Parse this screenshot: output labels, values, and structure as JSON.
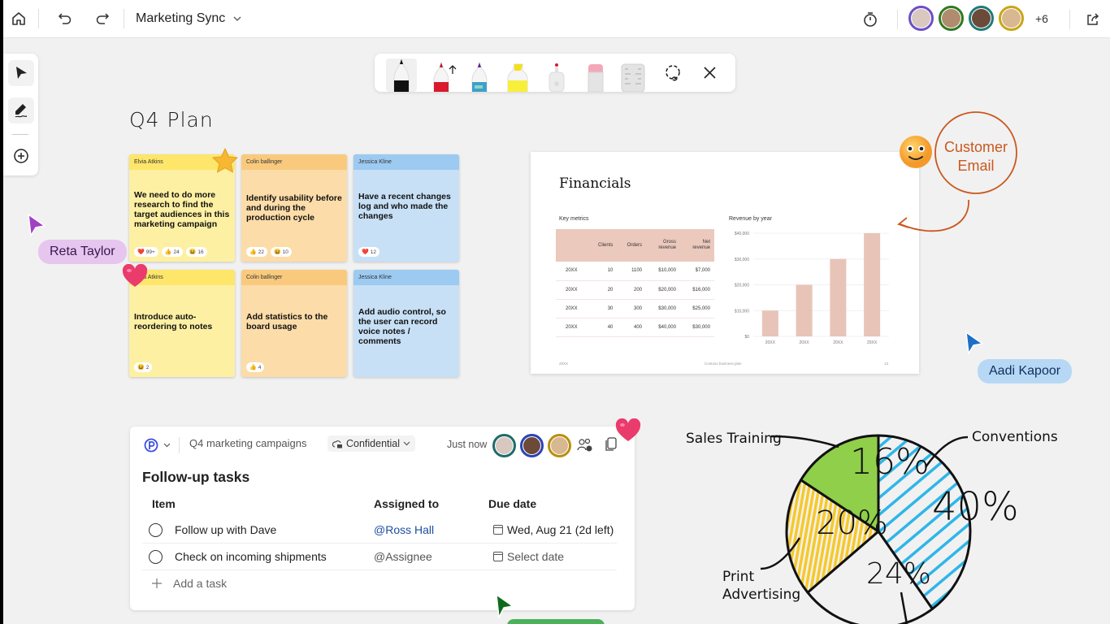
{
  "topbar": {
    "title": "Marketing Sync",
    "more_count": "+6",
    "avatars": [
      {
        "ring": "#6b4fc8",
        "fill": "#d8c8c0"
      },
      {
        "ring": "#2f7a1f",
        "fill": "#b08b6e"
      },
      {
        "ring": "#1f7a7a",
        "fill": "#6b4a3a"
      },
      {
        "ring": "#c9a515",
        "fill": "#d8b890"
      }
    ]
  },
  "leftbar": {
    "tools": [
      "select",
      "ink",
      "add"
    ]
  },
  "ink_toolbar": {
    "tools": [
      "black-pen",
      "red-pen",
      "galaxy-pen",
      "yellow-highlighter",
      "laser-pointer",
      "eraser",
      "ruler",
      "lasso-select",
      "close"
    ]
  },
  "board": {
    "title": "Q4 Plan",
    "notes": [
      {
        "author": "Elvia Atkins",
        "text": "We need to do more research to find the target audiences in this marketing campaign",
        "color": "y",
        "reactions": [
          {
            "icon": "heart",
            "count": "99+"
          },
          {
            "icon": "thumbs-up",
            "count": "24"
          },
          {
            "icon": "laugh",
            "count": "16"
          }
        ]
      },
      {
        "author": "Colin ballinger",
        "text": "Identify usability before and during the production cycle",
        "color": "o",
        "reactions": [
          {
            "icon": "thumbs-up",
            "count": "22"
          },
          {
            "icon": "laugh",
            "count": "10"
          }
        ]
      },
      {
        "author": "Jessica Kline",
        "text": "Have a recent changes log and who made the changes",
        "color": "b",
        "reactions": [
          {
            "icon": "heart",
            "count": "12"
          }
        ]
      },
      {
        "author": "Elvia Atkins",
        "text": "Introduce auto-reordering to notes",
        "color": "y",
        "reactions": [
          {
            "icon": "laugh",
            "count": "2"
          }
        ]
      },
      {
        "author": "Colin ballinger",
        "text": "Add statistics to the board usage",
        "color": "o",
        "reactions": [
          {
            "icon": "thumbs-up",
            "count": "4"
          }
        ]
      },
      {
        "author": "Jessica Kline",
        "text": "Add audio control, so the user can record voice notes / comments",
        "color": "b",
        "reactions": []
      }
    ]
  },
  "cursors": {
    "reta": {
      "name": "Reta Taylor",
      "color": "#a23fc2",
      "bg": "#e6c6ef"
    },
    "aadi": {
      "name": "Aadi Kapoor",
      "color": "#1c6fc7",
      "bg": "#b7d8f5"
    },
    "green": {
      "color": "#0f6b1c"
    }
  },
  "customer_email": {
    "label_line1": "Customer",
    "label_line2": "Email",
    "color": "#c9581f"
  },
  "slide": {
    "title": "Financials",
    "key_metrics_label": "Key metrics",
    "revenue_label": "Revenue by year",
    "table": {
      "headers": [
        "",
        "Clients",
        "Orders",
        "Gross revenue",
        "Net revenue"
      ],
      "rows": [
        [
          "20XX",
          "10",
          "1100",
          "$10,000",
          "$7,000"
        ],
        [
          "20XX",
          "20",
          "200",
          "$20,000",
          "$16,000"
        ],
        [
          "20XX",
          "30",
          "300",
          "$30,000",
          "$25,000"
        ],
        [
          "20XX",
          "40",
          "400",
          "$40,000",
          "$30,000"
        ]
      ]
    },
    "footer_left": "20XX",
    "footer_center": "Contoso business plan",
    "footer_right": "13"
  },
  "chart_data": [
    {
      "type": "bar",
      "title": "Revenue by year",
      "categories": [
        "20XX",
        "20XX",
        "20XX",
        "20XX"
      ],
      "values": [
        10000,
        20000,
        30000,
        40000
      ],
      "ylim": [
        0,
        40000
      ],
      "yticks": [
        "$0",
        "$10,000",
        "$20,000",
        "$30,000",
        "$40,000"
      ],
      "xlabel": "",
      "ylabel": "",
      "color": "#e8c4b8",
      "grid": true
    },
    {
      "type": "pie",
      "title": "",
      "categories": [
        "Conventions",
        "Sales Training",
        "Print Advertising",
        ""
      ],
      "values": [
        40,
        16,
        20,
        24
      ],
      "labels": [
        "40%",
        "16%",
        "20%",
        "24%"
      ]
    }
  ],
  "loop": {
    "workspace": "Q4 marketing campaigns",
    "sensitivity": "Confidential",
    "timestamp": "Just now",
    "title": "Follow-up tasks",
    "columns": [
      "Item",
      "Assigned to",
      "Due date"
    ],
    "rows": [
      {
        "item": "Follow up with Dave",
        "assignee": "@Ross Hall",
        "due": "Wed, Aug 21 (2d left)"
      },
      {
        "item": "Check on incoming shipments",
        "assignee": "@Assignee",
        "due": "Select date"
      }
    ],
    "add_label": "Add a task"
  }
}
